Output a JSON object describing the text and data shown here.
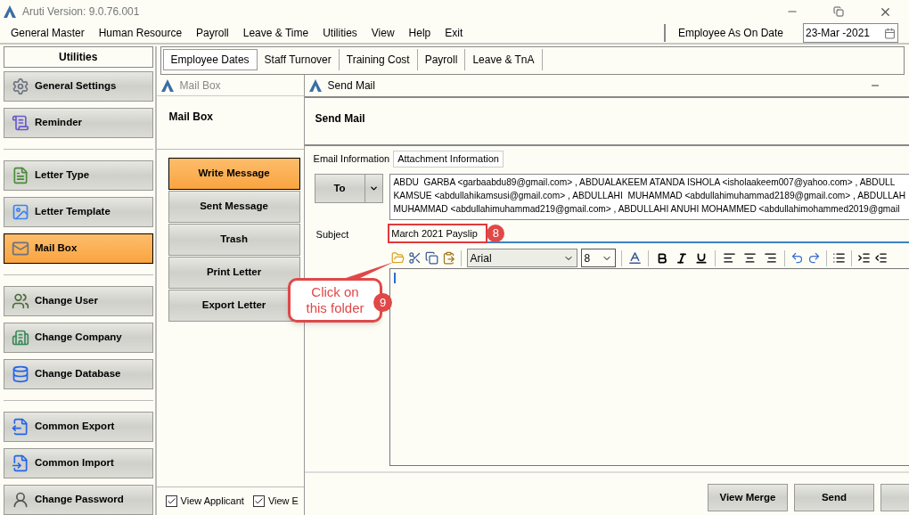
{
  "window": {
    "title": "Aruti Version: 9.0.76.001"
  },
  "menu": [
    "General Master",
    "Human Resource",
    "Payroll",
    "Leave & Time",
    "Utilities",
    "View",
    "Help",
    "Exit"
  ],
  "as_on_date": {
    "label": "Employee As On Date",
    "value": "23-Mar -2021"
  },
  "sidebar": {
    "title": "Utilities",
    "groups": [
      {
        "items": [
          {
            "label": "General Settings",
            "selected": false
          },
          {
            "label": "Reminder",
            "selected": false
          }
        ]
      },
      {
        "items": [
          {
            "label": "Letter Type",
            "selected": false
          },
          {
            "label": "Letter Template",
            "selected": false
          },
          {
            "label": "Mail Box",
            "selected": true
          }
        ]
      },
      {
        "items": [
          {
            "label": "Change User",
            "selected": false
          },
          {
            "label": "Change Company",
            "selected": false
          },
          {
            "label": "Change Database",
            "selected": false
          }
        ]
      },
      {
        "items": [
          {
            "label": "Common Export",
            "selected": false
          },
          {
            "label": "Common Import",
            "selected": false
          },
          {
            "label": "Change Password",
            "selected": false
          }
        ]
      }
    ]
  },
  "tabs": [
    {
      "label": "Employee Dates",
      "selected": true
    },
    {
      "label": "Staff Turnover",
      "selected": false
    },
    {
      "label": "Training Cost",
      "selected": false
    },
    {
      "label": "Payroll",
      "selected": false
    },
    {
      "label": "Leave & TnA",
      "selected": false
    }
  ],
  "mail_box": {
    "title": "Mail Box",
    "heading": "Mail Box",
    "actions": [
      {
        "label": "Write Message",
        "selected": true
      },
      {
        "label": "Sent Message",
        "selected": false
      },
      {
        "label": "Trash",
        "selected": false
      },
      {
        "label": "Print Letter",
        "selected": false
      },
      {
        "label": "Export Letter",
        "selected": false
      }
    ],
    "options": [
      {
        "label": "View Applicant",
        "checked": true
      },
      {
        "label": "View E",
        "checked": true
      }
    ]
  },
  "send_mail": {
    "title": "Send Mail",
    "heading": "Send Mail",
    "tabs": [
      {
        "label": "Email Information",
        "selected": true
      },
      {
        "label": "Attachment Information",
        "selected": false
      }
    ],
    "to_button": "To",
    "recipients": [
      "ABDU  GARBA <garbaabdu89@gmail.com> , ABDUALAKEEM ATANDA ISHOLA <isholaakeem007@yahoo.com> , ABDULL",
      "KAMSUE <abdullahikamsusi@gmail.com> , ABDULLAHI  MUHAMMAD <abdullahimuhammad2189@gmail.com> , ABDULLAH",
      "MUHAMMAD <abdullahimuhammad219@gmail.com> , ABDULLAHI ANUHI MOHAMMED <abdullahimohammed2019@gmail"
    ],
    "subject": {
      "label": "Subject",
      "value": "March 2021 Payslip"
    },
    "toolbar": {
      "font": "Arial",
      "size": "8"
    },
    "buttons": [
      "View Merge",
      "Send"
    ]
  },
  "annotations": [
    {
      "number": "8"
    },
    {
      "number": "9",
      "text": "Click on this folder"
    }
  ]
}
